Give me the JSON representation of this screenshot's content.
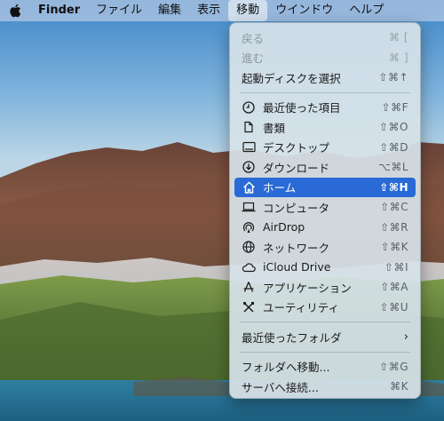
{
  "menubar": {
    "apple_icon": "apple-logo-icon",
    "app_name": "Finder",
    "items": [
      "ファイル",
      "編集",
      "表示",
      "移動",
      "ウインドウ",
      "ヘルプ"
    ],
    "active": "移動"
  },
  "menu": {
    "back": {
      "label": "戻る",
      "shortcut": "⌘ ["
    },
    "forward": {
      "label": "進む",
      "shortcut": "⌘ ]"
    },
    "startup_disk": {
      "label": "起動ディスクを選択",
      "shortcut": "⇧⌘↑"
    },
    "items": [
      {
        "label": "最近使った項目",
        "shortcut": "⇧⌘F",
        "icon": "clock-icon"
      },
      {
        "label": "書類",
        "shortcut": "⇧⌘O",
        "icon": "document-icon"
      },
      {
        "label": "デスクトップ",
        "shortcut": "⇧⌘D",
        "icon": "desktop-icon"
      },
      {
        "label": "ダウンロード",
        "shortcut": "⌥⌘L",
        "icon": "download-icon"
      },
      {
        "label": "ホーム",
        "shortcut": "⇧⌘H",
        "icon": "home-icon"
      },
      {
        "label": "コンピュータ",
        "shortcut": "⇧⌘C",
        "icon": "laptop-icon"
      },
      {
        "label": "AirDrop",
        "shortcut": "⇧⌘R",
        "icon": "airdrop-icon"
      },
      {
        "label": "ネットワーク",
        "shortcut": "⇧⌘K",
        "icon": "globe-icon"
      },
      {
        "label": "iCloud Drive",
        "shortcut": "⇧⌘I",
        "icon": "cloud-icon"
      },
      {
        "label": "アプリケーション",
        "shortcut": "⇧⌘A",
        "icon": "applications-icon"
      },
      {
        "label": "ユーティリティ",
        "shortcut": "⇧⌘U",
        "icon": "utilities-icon"
      }
    ],
    "recent_folders": {
      "label": "最近使ったフォルダ",
      "chevron": "›"
    },
    "go_to_folder": {
      "label": "フォルダへ移動...",
      "shortcut": "⇧⌘G"
    },
    "connect_server": {
      "label": "サーバへ接続...",
      "shortcut": "⌘K"
    }
  },
  "colors": {
    "highlight": "#2a6ad6",
    "menubar_active": "#ffffff"
  }
}
